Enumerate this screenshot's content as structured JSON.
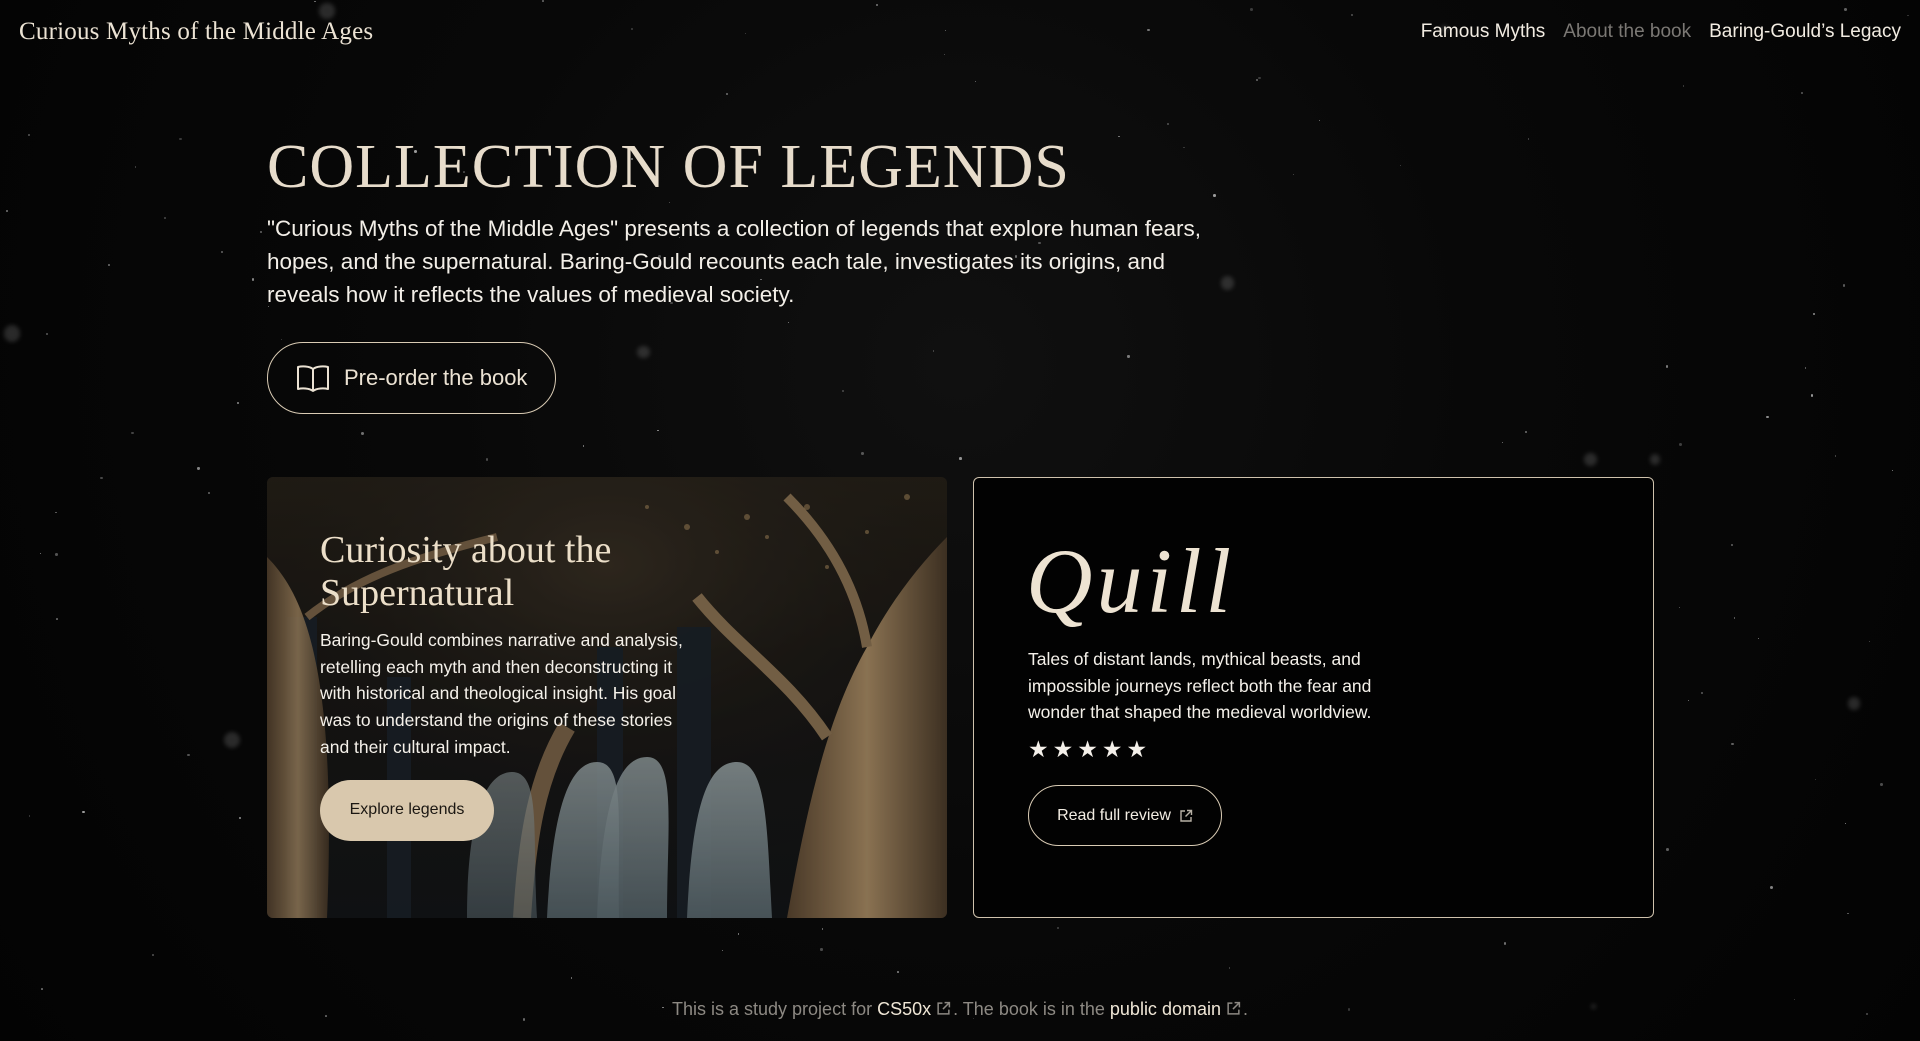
{
  "header": {
    "brand": "Curious Myths of the Middle Ages",
    "nav": [
      {
        "label": "Famous Myths"
      },
      {
        "label": "About the book"
      },
      {
        "label": "Baring-Gould’s Legacy"
      }
    ]
  },
  "hero": {
    "title": "COLLECTION OF LEGENDS",
    "description": "\"Curious Myths of the Middle Ages\" presents a collection of legends that explore human fears, hopes, and the supernatural. Baring-Gould recounts each tale, investigates its origins, and reveals how it reflects the values of medieval society.",
    "preorder_label": "Pre-order the book",
    "preorder_icon": "book-open-icon"
  },
  "feature_card": {
    "title": "Curiosity about the Supernatural",
    "body": "Baring-Gould combines narrative and analysis, retelling each myth and then deconstructing it with historical and theological insight. His goal was to understand the origins of these stories and their cultural impact.",
    "button_label": "Explore legends"
  },
  "review_card": {
    "logo_text": "Quill",
    "text": "Tales of distant lands, mythical beasts, and impossible journeys reflect both the fear and wonder that shaped the medieval worldview.",
    "rating": 5,
    "rating_max": 5,
    "button_label": "Read full review"
  },
  "footer": {
    "prefix": "This is a study project for",
    "link1": "CS50x",
    "middle": ". The book is in the",
    "link2": "public domain",
    "suffix": "."
  },
  "colors": {
    "background": "#050505",
    "accent": "#d9c8ad",
    "heading": "#e7dccb",
    "muted_nav": "#7b7874"
  }
}
